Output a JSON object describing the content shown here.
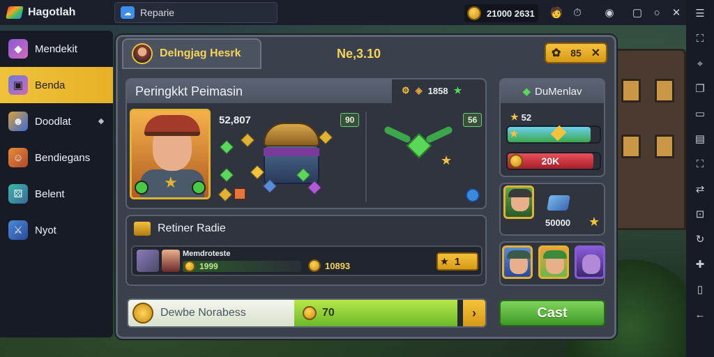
{
  "app": {
    "brand": "Hagotlah",
    "tab_label": "Reparie",
    "coins": "21000 2631"
  },
  "sidebar": {
    "items": [
      {
        "label": "Mendekit",
        "icon": "crystal-icon",
        "active": false
      },
      {
        "label": "Benda",
        "icon": "cube-icon",
        "active": true
      },
      {
        "label": "Doodlat",
        "icon": "mask-icon",
        "active": false,
        "has_dot": true
      },
      {
        "label": "Bendiegans",
        "icon": "hero-icon",
        "active": false
      },
      {
        "label": "Belent",
        "icon": "dice-icon",
        "active": false
      },
      {
        "label": "Nyot",
        "icon": "sword-icon",
        "active": false
      }
    ]
  },
  "panel": {
    "tab_title": "Delngjag Hesrk",
    "center_title": "Ne,3.10",
    "top_badge": "85",
    "section1": {
      "title": "Peringkkt Peimasin",
      "counter": "1858",
      "hero_value": "52,807",
      "green_label_1": "90",
      "green_label_2": "56"
    },
    "section2": {
      "title": "Retiner Radie",
      "item_name": "Memdroteste",
      "price_1": "1999",
      "price_2": "10893",
      "qty": "1"
    },
    "progress": {
      "label": "Dewbe Norabess",
      "value": "70",
      "fill_fraction": 0.95
    }
  },
  "right": {
    "header": "DuMenlav",
    "star_value": "52",
    "bar_red_label": "20K",
    "resource_value": "50000",
    "cast_label": "Cast",
    "green_bar_fraction": 0.9,
    "red_bar_fraction": 0.93
  },
  "colors": {
    "accent_gold": "#f5c23c",
    "active_item": "#f0c23c",
    "green": "#6cb82a",
    "red": "#c8323a"
  }
}
